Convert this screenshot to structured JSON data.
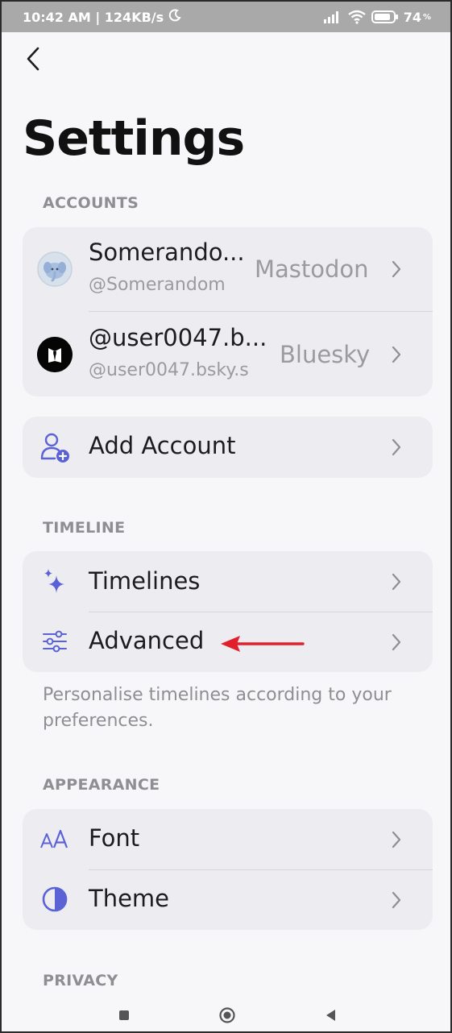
{
  "status_bar": {
    "time_speed": "10:42 AM | 124KB/s",
    "battery_percent": "74"
  },
  "header": {
    "back_icon": "chevron-left-icon",
    "title": "Settings"
  },
  "accounts_section": {
    "label": "ACCOUNTS",
    "accounts": [
      {
        "name": "Somerando...",
        "handle": "@Somerandom",
        "service": "Mastodon",
        "avatar": "mastodon-avatar"
      },
      {
        "name": "@user0047.b...",
        "handle": "@user0047.bsky.s",
        "service": "Bluesky",
        "avatar": "bluesky-avatar"
      }
    ],
    "add_account_label": "Add Account"
  },
  "timeline_section": {
    "label": "TIMELINE",
    "items": [
      {
        "label": "Timelines",
        "icon": "sparkles-icon"
      },
      {
        "label": "Advanced",
        "icon": "sliders-icon"
      }
    ],
    "helper": "Personalise timelines according to your preferences."
  },
  "appearance_section": {
    "label": "APPEARANCE",
    "items": [
      {
        "label": "Font",
        "icon": "font-size-icon"
      },
      {
        "label": "Theme",
        "icon": "theme-contrast-icon"
      }
    ]
  },
  "privacy_section": {
    "label": "PRIVACY"
  },
  "colors": {
    "accent": "#5a62d6",
    "annotation_arrow": "#e0202a"
  }
}
